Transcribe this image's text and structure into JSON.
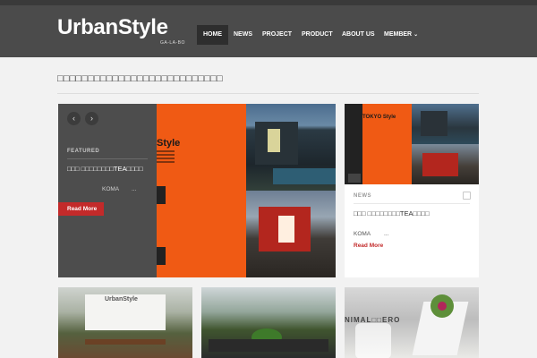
{
  "header": {
    "logo": "UrbanStyle",
    "logo_sub": "GA-LA-BO",
    "nav": [
      {
        "label": "HOME",
        "active": true
      },
      {
        "label": "NEWS",
        "active": false
      },
      {
        "label": "PROJECT",
        "active": false
      },
      {
        "label": "PRODUCT",
        "active": false
      },
      {
        "label": "ABOUT US",
        "active": false
      },
      {
        "label": "MEMBER",
        "active": false,
        "dropdown": true
      }
    ],
    "caret": "⌄"
  },
  "page": {
    "title": "□□□□□□□□□□□□□□□□□□□□□□□□□□□"
  },
  "featured": {
    "prev_glyph": "‹",
    "next_glyph": "›",
    "label": "FEATURED",
    "title": "□□□ □□□□□□□□TEA□□□□",
    "author": "KOMA",
    "ellipsis": "...",
    "read_more": "Read More",
    "slide_brand": "Style"
  },
  "side_card": {
    "label": "NEWS",
    "image_caption": "TOKYO Style",
    "title": "□□□ □□□□□□□□TEA□□□□",
    "author": "KOMA",
    "ellipsis": "...",
    "read_more": "Read More"
  },
  "thumbs": [
    {
      "caption": "UrbanStyle"
    },
    {
      "caption": ""
    },
    {
      "caption": "NIMAL□□ERO"
    }
  ],
  "colors": {
    "header_bg": "#4b4b4b",
    "accent_red": "#c32a2a",
    "slide_orange": "#f05a14",
    "page_bg": "#f2f2f2"
  }
}
